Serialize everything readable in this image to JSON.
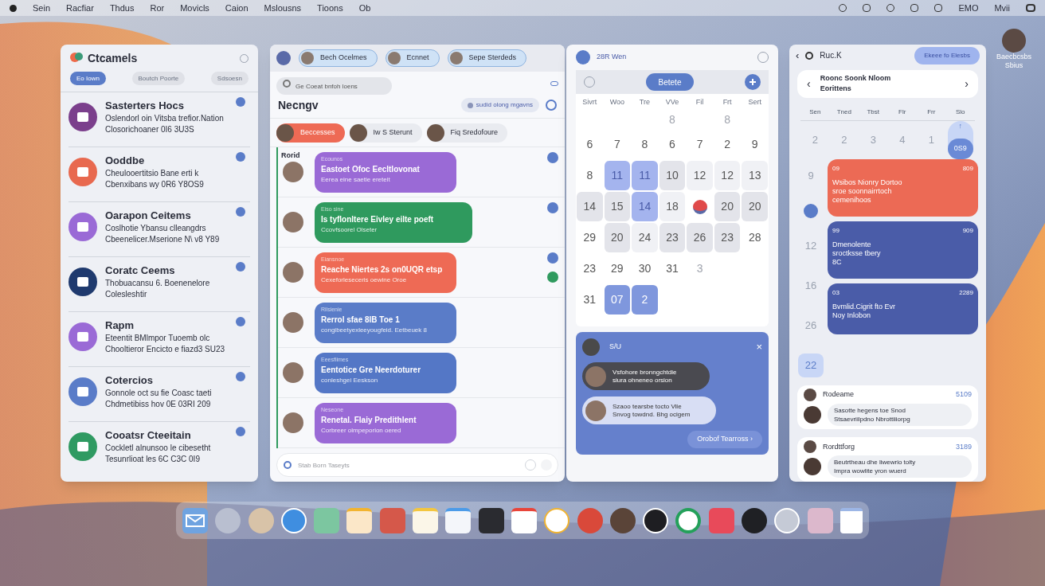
{
  "menu_bar": {
    "items": [
      "Sein",
      "Racfiar",
      "Thdus",
      "Ror",
      "Movicls",
      "Caion",
      "Mslousns",
      "Tioons",
      "Ob"
    ],
    "status": [
      "EMO",
      "Mvii"
    ]
  },
  "desktop_user": {
    "lines": [
      "Baecbcsbs",
      "Sbius"
    ]
  },
  "channels_window": {
    "title": "Ctcamels",
    "filters": [
      {
        "label": "Eo Iown",
        "selected": true
      },
      {
        "label": "Boutch Poorte",
        "selected": false
      },
      {
        "label": "Sdsoesn",
        "selected": false
      }
    ],
    "items": [
      {
        "title": "Sasterters Hocs",
        "line1": "Oslendorl oin Vitsba trefior.Nation",
        "line2": "Closorichoaner 0I6 3U3S",
        "color": "#7b3f8c"
      },
      {
        "title": "Ooddbe",
        "line1": "Cheulooertitsio Bane erti k",
        "line2": "Cbenxibans wy 0R6 Y8OS9",
        "color": "#e8694f"
      },
      {
        "title": "Oarapon Ceitems",
        "line1": "Coslhotie Ybansu clleangdrs",
        "line2": "Cbeenelicer.Mserione N\\ v8 Y89",
        "color": "#9a6ad6"
      },
      {
        "title": "Coratc Ceems",
        "line1": "Thobuacansu 6. Boenenelore",
        "line2": "Colesleshtir",
        "color": "#1f3a6e"
      },
      {
        "title": "Rapm",
        "line1": "Eteentit BMlmpor Tuoemb olc",
        "line2": "Chooltieror Encicto e fiazd3 SU23",
        "color": "#9a6ad6"
      },
      {
        "title": "Cotercios",
        "line1": "Gonnole oct su fie Coasc taeti",
        "line2": "Chdmetibiss hov 0E 03RI 209",
        "color": "#5a7cc8"
      },
      {
        "title": "Cooatsr Cteeitain",
        "line1": "Cockletl alnunsoo le cibesetht",
        "line2": "Tesunrlioat les 6C C3C 0I9",
        "color": "#2f9a62"
      }
    ]
  },
  "messages_window": {
    "people": [
      {
        "label": "Bech Ocelmes"
      },
      {
        "label": "Ecnnet"
      },
      {
        "label": "Sepe Sterdeds"
      }
    ],
    "search": {
      "placeholder": "Ge Coeat bnfoh loens"
    },
    "heading": "Necngv",
    "filter_pill": "sudid olong mgavns",
    "chips": [
      {
        "label": "Beccesses",
        "selected": true
      },
      {
        "label": "Iw S Sterunt",
        "selected": false
      },
      {
        "label": "Fiq Sredofoure",
        "selected": false
      }
    ],
    "timeline_label": "Rorid",
    "cards": [
      {
        "tag": "Ecounos",
        "title": "Eastoet Ofoc Eecltlovonat",
        "subtitle": "Eerea eine saetie ereteit",
        "color": "#9a6ad6",
        "wide": false,
        "badges": [
          {
            "color": "#5a7cc8"
          }
        ]
      },
      {
        "tag": "Eiso sine",
        "title": "Is tyflonltere Eivley eilte poeft",
        "subtitle": "Ccovfsoorel Olseter",
        "color": "#2f9a5e",
        "wide": true,
        "badges": [
          {
            "color": "#5a7cc8"
          }
        ]
      },
      {
        "tag": "Eiansnoe",
        "title": "Reache Niertes 2s on0UQR etsp",
        "subtitle": "Cexeforleseceris oewine Oroe",
        "color": "#ee6a55",
        "wide": false,
        "badges": [
          {
            "color": "#5a7cc8"
          },
          {
            "color": "#2f9a5e"
          }
        ]
      },
      {
        "tag": "Rilsienie",
        "title": "Rerrol sfae 8lB Toe 1",
        "subtitle": "congibeetyexleeyougfeid. Eetbeuek 8",
        "color": "#5a7cc8",
        "wide": false
      },
      {
        "tag": "Eeesfiimes",
        "title": "Eentotice Gre Neerdoturer",
        "subtitle": "conleshgei Eeskson",
        "color": "#5477c6",
        "wide": false
      },
      {
        "tag": "Neseone",
        "title": "Renetal. Flaiy Predithlent",
        "subtitle": "Corbreer olmpeporion oered",
        "color": "#9a6ad6",
        "wide": false
      }
    ],
    "composer": {
      "placeholder": "Stab Born Taseyts"
    }
  },
  "calendar_window": {
    "title": "28R Wen",
    "button": "Betete",
    "weekdays": [
      "Sivrt",
      "Woo",
      "Tre",
      "VVe",
      "Fil",
      "Frt",
      "Sert"
    ],
    "weeks": [
      [
        {
          "kind": "blank"
        },
        {
          "kind": "blank"
        },
        {
          "kind": "blank"
        },
        {
          "day": "8",
          "kind": "faint"
        },
        {
          "kind": "blank"
        },
        {
          "day": "8",
          "kind": "faint"
        },
        {
          "kind": "blank"
        }
      ],
      [
        {
          "day": "6",
          "kind": "plain"
        },
        {
          "day": "7",
          "kind": "plain"
        },
        {
          "day": "8",
          "kind": "plain"
        },
        {
          "day": "6",
          "kind": "plain"
        },
        {
          "day": "7",
          "kind": "plain"
        },
        {
          "day": "2",
          "kind": "plain"
        },
        {
          "day": "9",
          "kind": "plain"
        }
      ],
      [
        {
          "day": "8",
          "kind": "plain"
        },
        {
          "day": "11",
          "kind": "selected"
        },
        {
          "day": "11",
          "kind": "selected"
        },
        {
          "day": "10",
          "kind": "shaded"
        },
        {
          "day": "12",
          "kind": "light"
        },
        {
          "day": "12",
          "kind": "light"
        },
        {
          "day": "13",
          "kind": "light"
        }
      ],
      [
        {
          "day": "14",
          "kind": "shaded"
        },
        {
          "day": "15",
          "kind": "shaded"
        },
        {
          "day": "14",
          "kind": "selected"
        },
        {
          "day": "18",
          "kind": "light"
        },
        {
          "kind": "pin"
        },
        {
          "day": "20",
          "kind": "shaded"
        },
        {
          "day": "20",
          "kind": "shaded"
        }
      ],
      [
        {
          "day": "29",
          "kind": "plain"
        },
        {
          "day": "20",
          "kind": "shaded"
        },
        {
          "day": "24",
          "kind": "light"
        },
        {
          "day": "23",
          "kind": "shaded"
        },
        {
          "day": "26",
          "kind": "shaded"
        },
        {
          "day": "23",
          "kind": "shaded"
        },
        {
          "day": "28",
          "kind": "plain"
        }
      ],
      [
        {
          "day": "23",
          "kind": "plain"
        },
        {
          "day": "29",
          "kind": "plain"
        },
        {
          "day": "30",
          "kind": "plain"
        },
        {
          "day": "31",
          "kind": "plain"
        },
        {
          "day": "3",
          "kind": "faint"
        },
        {
          "kind": "blank"
        },
        {
          "kind": "blank"
        }
      ],
      [
        {
          "day": "31",
          "kind": "plain"
        },
        {
          "day": "07",
          "kind": "highlight"
        },
        {
          "day": "2",
          "kind": "highlight"
        },
        {
          "kind": "blank"
        },
        {
          "kind": "blank"
        },
        {
          "kind": "blank"
        },
        {
          "kind": "blank"
        }
      ]
    ],
    "chat": {
      "title": "S/U",
      "close": "×",
      "bubbles": [
        {
          "kind": "dark",
          "lines": [
            "Vsfohore bronngchtdie",
            "siura ohneneo orsion"
          ]
        },
        {
          "kind": "light",
          "lines": [
            "Szaoo tearsbe tocto Vile",
            "Snvog towdnd. Bhg ocigem"
          ]
        }
      ],
      "button": "Orobof Tearross ›"
    }
  },
  "agenda_window": {
    "back": "‹",
    "title": "Ruc.K",
    "action": "Ekeee fo Elesbs",
    "month": {
      "previous": "‹",
      "title": "Roonc Soonk Nloom",
      "subtitle": "Eorittens",
      "next": "›"
    },
    "weekdays": [
      "Sen",
      "Tned",
      "Tbst",
      "Flr",
      "Frr",
      "Slo"
    ],
    "days": [
      "2",
      "2",
      "3",
      "4",
      "1"
    ],
    "today": {
      "top": "↑",
      "bottom": "0S9"
    },
    "hours": [
      {
        "label": "9",
        "selected": false
      },
      {
        "label": "12",
        "selected": false
      },
      {
        "label": "16",
        "selected": false
      },
      {
        "label": "26",
        "selected": false
      },
      {
        "label": "22",
        "selected": true
      }
    ],
    "events": [
      {
        "time": "09",
        "code": "809",
        "lines": [
          "Wsibos Nionry Dortoo",
          "sroe soonnairrtoch",
          "cemenihoos"
        ],
        "color": "#ec6a55"
      },
      {
        "time": "99",
        "code": "909",
        "lines": [
          "Dmenolente",
          "sroctksse tbery",
          "8C"
        ],
        "color": "#4a5ca8"
      },
      {
        "time": "03",
        "code": "2289",
        "lines": [
          "Bvmlid.Cigrit fto Evr",
          "Noy Inlobon"
        ],
        "color": "#4a5ca8"
      }
    ],
    "notes": [
      {
        "name": "Rodeame",
        "code": "5109",
        "lines": [
          "Sasotte hegens toe Snod",
          "Stsaevriilpdno Nbrottiiiorpg"
        ]
      },
      {
        "name": "Rordttforg",
        "code": "3189",
        "lines": [
          "Beutrtheau dhe liwewrio tolty",
          "Impra wowlite yron wuerd"
        ]
      }
    ]
  }
}
